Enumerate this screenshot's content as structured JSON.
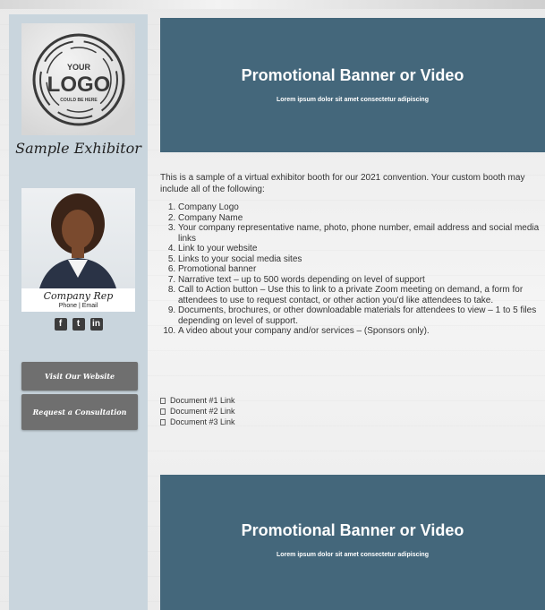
{
  "sidebar": {
    "logo": {
      "line1": "YOUR",
      "line2": "LOGO",
      "line3": "COULD BE HERE"
    },
    "exhibitor_name": "Sample Exhibitor",
    "rep": {
      "name": "Company Rep",
      "contact": "Phone | Email"
    },
    "social": [
      {
        "icon": "facebook-icon",
        "glyph": "f"
      },
      {
        "icon": "twitter-icon",
        "glyph": "t"
      },
      {
        "icon": "linkedin-icon",
        "glyph": "in"
      }
    ],
    "buttons": {
      "website": "Visit Our Website",
      "consult": "Request a Consultation"
    }
  },
  "banner_top": {
    "title": "Promotional Banner or Video",
    "subtitle": "Lorem ipsum dolor sit amet consectetur adipiscing"
  },
  "banner_bottom": {
    "title": "Promotional Banner or Video",
    "subtitle": "Lorem ipsum dolor sit amet consectetur adipiscing"
  },
  "content": {
    "intro": "This is a sample of a virtual exhibitor booth for our 2021 convention. Your custom booth may include all of the following:",
    "items": [
      "Company Logo",
      "Company Name",
      "Your company representative name, photo, phone number, email address and social media links",
      "Link to your website",
      "Links to your social media sites",
      "Promotional banner",
      "Narrative text – up to 500 words depending on level of support",
      "Call to Action button – Use this to link to a private Zoom meeting on demand, a form for attendees to use to request contact, or other action you'd like attendees to take.",
      "Documents, brochures, or other downloadable materials for attendees to view – 1 to 5 files depending on level of support.",
      "A video about your company and/or services – (Sponsors only)."
    ],
    "documents": [
      "Document #1 Link",
      "Document #2 Link",
      "Document #3 Link"
    ]
  },
  "colors": {
    "banner": "#44677b",
    "sidebar": "#c9d5dd",
    "button": "#6f6f6f"
  }
}
